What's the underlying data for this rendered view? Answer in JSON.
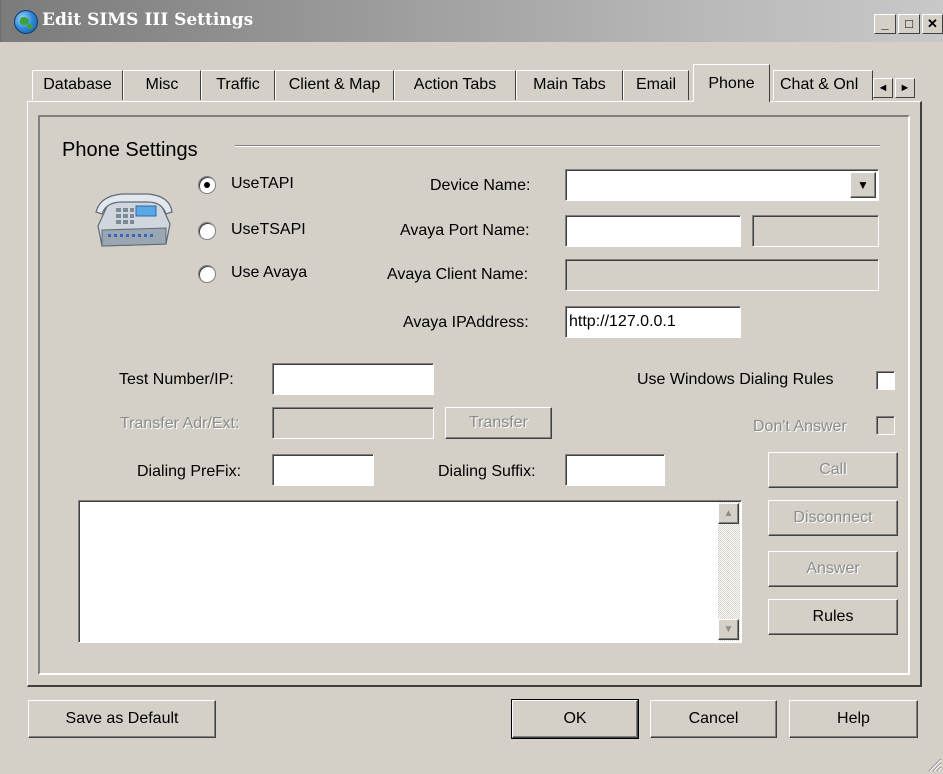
{
  "window": {
    "title": "Edit SIMS III Settings",
    "minimize_glyph": "_",
    "maximize_glyph": "□",
    "close_glyph": "✕"
  },
  "tabs": [
    "Database",
    "Misc",
    "Traffic",
    "Client & Map",
    "Action Tabs",
    "Main Tabs",
    "Email",
    "Phone",
    "Chat & Onl"
  ],
  "active_tab": "Phone",
  "tab_scroll": {
    "left_glyph": "◄",
    "right_glyph": "►"
  },
  "group": {
    "title": "Phone Settings"
  },
  "icons": {
    "phone": "desk-phone-icon",
    "app": "globe-icon"
  },
  "radios": [
    {
      "label": "UseTAPI",
      "checked": true
    },
    {
      "label": "UseTSAPI",
      "checked": false
    },
    {
      "label": "Use Avaya",
      "checked": false
    }
  ],
  "fields": {
    "device_name": {
      "label": "Device Name:",
      "value": ""
    },
    "avaya_port_name": {
      "label": "Avaya Port Name:",
      "value": "",
      "value2": ""
    },
    "avaya_client_name": {
      "label": "Avaya Client Name:",
      "value": ""
    },
    "avaya_ip": {
      "label": "Avaya IPAddress:",
      "value": "http://127.0.0.1"
    },
    "test_number": {
      "label": "Test Number/IP:",
      "value": ""
    },
    "transfer_adr": {
      "label": "Transfer Adr/Ext:",
      "value": ""
    },
    "dialing_prefix": {
      "label": "Dialing PreFix:",
      "value": ""
    },
    "dialing_suffix": {
      "label": "Dialing Suffix:",
      "value": ""
    }
  },
  "checkboxes": {
    "use_windows_dialing_rules": {
      "label": "Use Windows Dialing Rules",
      "checked": false
    },
    "dont_answer": {
      "label": "Don't Answer",
      "checked": false
    }
  },
  "buttons": {
    "transfer": "Transfer",
    "call": "Call",
    "disconnect": "Disconnect",
    "answer": "Answer",
    "rules": "Rules",
    "save_default": "Save as Default",
    "ok": "OK",
    "cancel": "Cancel",
    "help": "Help"
  },
  "log": {
    "text": "",
    "scroll_up": "▲",
    "scroll_down": "▼"
  },
  "dropdown_glyph": "▼"
}
